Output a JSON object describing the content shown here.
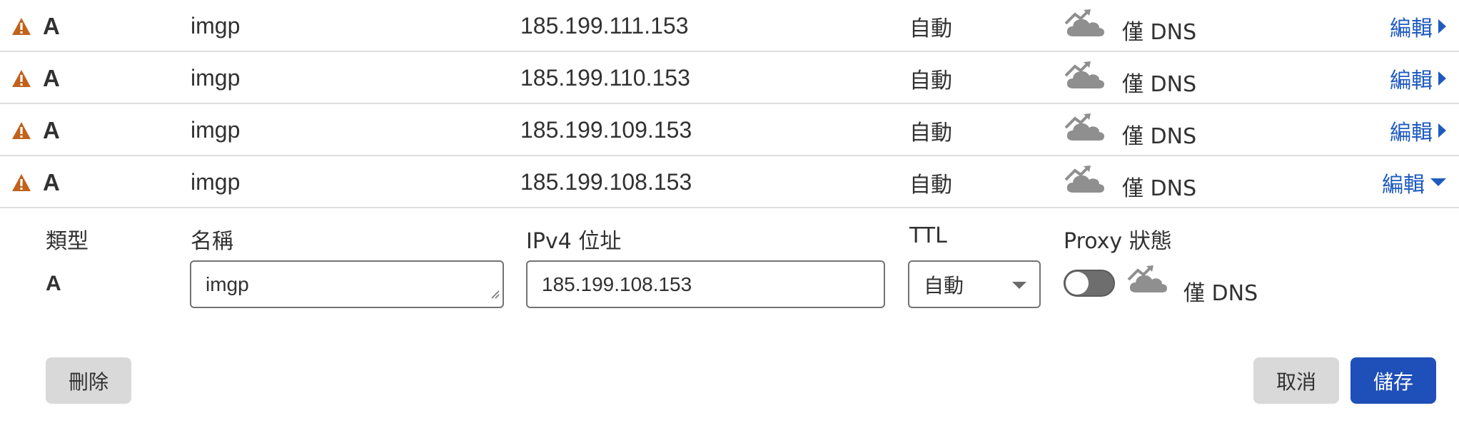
{
  "records": [
    {
      "type": "A",
      "name": "imgp",
      "content": "185.199.111.153",
      "ttl": "自動",
      "proxy": "僅 DNS",
      "edit": "編輯",
      "expanded": false
    },
    {
      "type": "A",
      "name": "imgp",
      "content": "185.199.110.153",
      "ttl": "自動",
      "proxy": "僅 DNS",
      "edit": "編輯",
      "expanded": false
    },
    {
      "type": "A",
      "name": "imgp",
      "content": "185.199.109.153",
      "ttl": "自動",
      "proxy": "僅 DNS",
      "edit": "編輯",
      "expanded": false
    },
    {
      "type": "A",
      "name": "imgp",
      "content": "185.199.108.153",
      "ttl": "自動",
      "proxy": "僅 DNS",
      "edit": "編輯",
      "expanded": true
    }
  ],
  "editor": {
    "labels": {
      "type": "類型",
      "name": "名稱",
      "ipv4": "IPv4 位址",
      "ttl": "TTL",
      "proxy": "Proxy 狀態"
    },
    "type_value": "A",
    "name_value": "imgp",
    "ipv4_value": "185.199.108.153",
    "ttl_value": "自動",
    "proxy_enabled": false,
    "proxy_label": "僅 DNS",
    "delete_label": "刪除",
    "cancel_label": "取消",
    "save_label": "儲存"
  },
  "icons": {
    "warning": "warning-icon",
    "cloud": "dns-only-cloud-icon",
    "edit_arrow": "triangle-icon"
  },
  "colors": {
    "accent": "#1f5bbf",
    "warning": "#c1621c",
    "cloud": "#8f8f8f",
    "save_button": "#1f4fb9"
  }
}
